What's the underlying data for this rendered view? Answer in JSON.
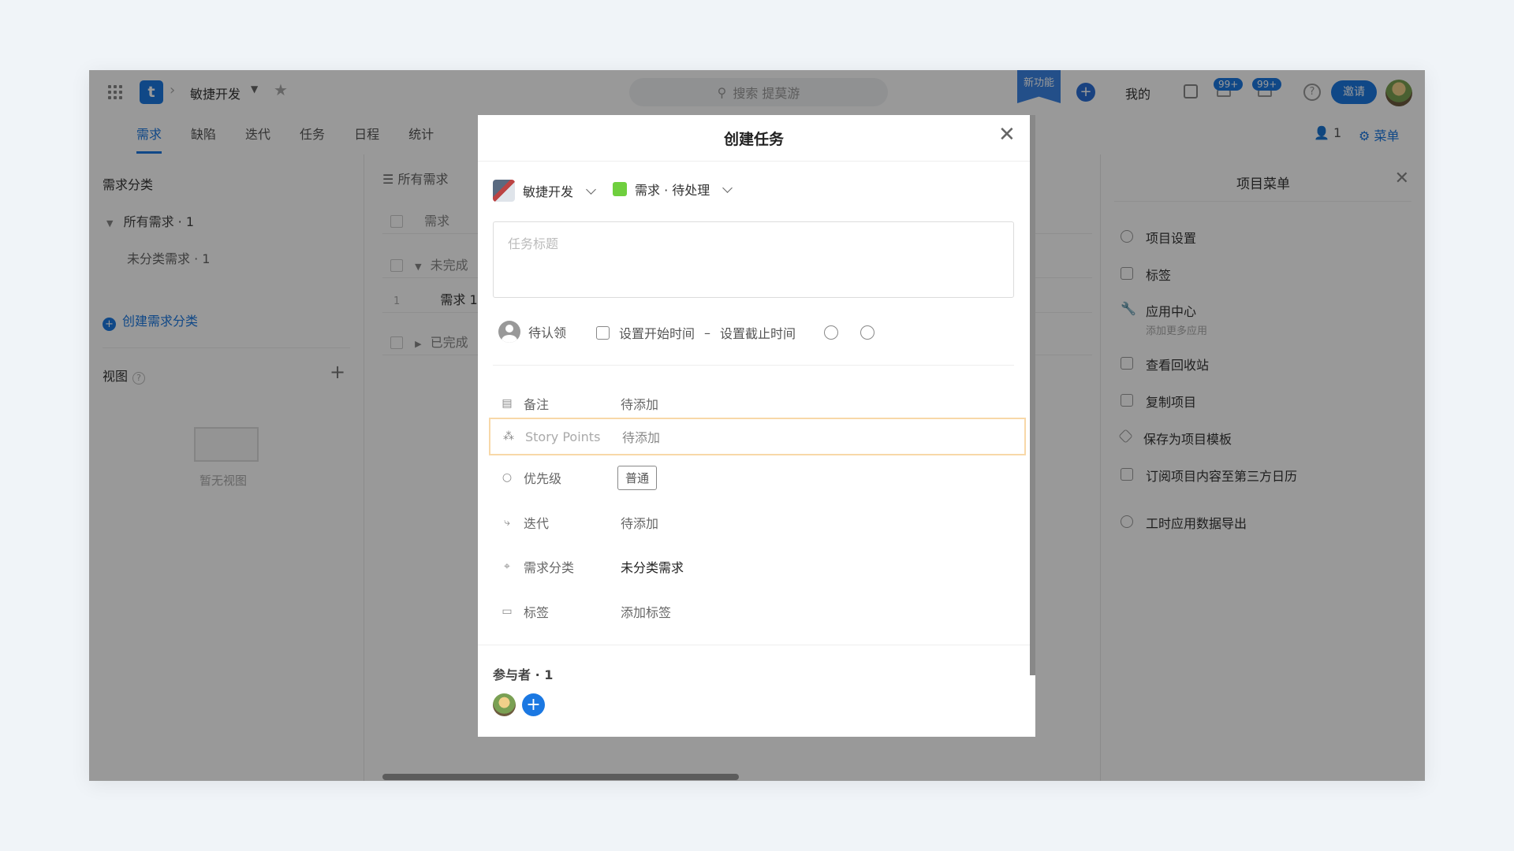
{
  "topbar": {
    "project": "敏捷开发",
    "search_placeholder": "搜索 提莫游",
    "new_feature": "新功能",
    "mine": "我的",
    "badge1": "99+",
    "badge2": "99+",
    "invite": "邀请",
    "logo": "t"
  },
  "tabs": [
    "需求",
    "缺陷",
    "迭代",
    "任务",
    "日程",
    "统计"
  ],
  "header_right": {
    "members": "1",
    "menu": "菜单"
  },
  "sidebar": {
    "title": "需求分类",
    "all": "所有需求 · 1",
    "uncategorized": "未分类需求 · 1",
    "create": "创建需求分类",
    "view_title": "视图",
    "empty_view": "暂无视图"
  },
  "list": {
    "header": "所有需求",
    "col_title": "需求",
    "group_unfinished": "未完成",
    "row_index": "1",
    "row_title": "需求 1",
    "group_finished": "已完成"
  },
  "right_panel": {
    "title": "项目菜单",
    "items": [
      {
        "label": "项目设置"
      },
      {
        "label": "标签"
      },
      {
        "label": "应用中心",
        "sub": "添加更多应用"
      },
      {
        "label": "查看回收站"
      },
      {
        "label": "复制项目"
      },
      {
        "label": "保存为项目模板"
      },
      {
        "label": "订阅项目内容至第三方日历"
      },
      {
        "label": "工时应用数据导出"
      }
    ]
  },
  "modal": {
    "title": "创建任务",
    "project": "敏捷开发",
    "type": "需求 · 待处理",
    "title_placeholder": "任务标题",
    "assignee": "待认领",
    "start_time": "设置开始时间",
    "date_sep": "–",
    "end_time": "设置截止时间",
    "fields": [
      {
        "label": "备注",
        "value": "待添加"
      },
      {
        "label": "Story Points",
        "value": "待添加"
      },
      {
        "label": "优先级",
        "value": "普通"
      },
      {
        "label": "迭代",
        "value": "待添加"
      },
      {
        "label": "需求分类",
        "value": "未分类需求"
      },
      {
        "label": "标签",
        "value": "添加标签"
      }
    ],
    "participants": "参与者 · 1"
  }
}
